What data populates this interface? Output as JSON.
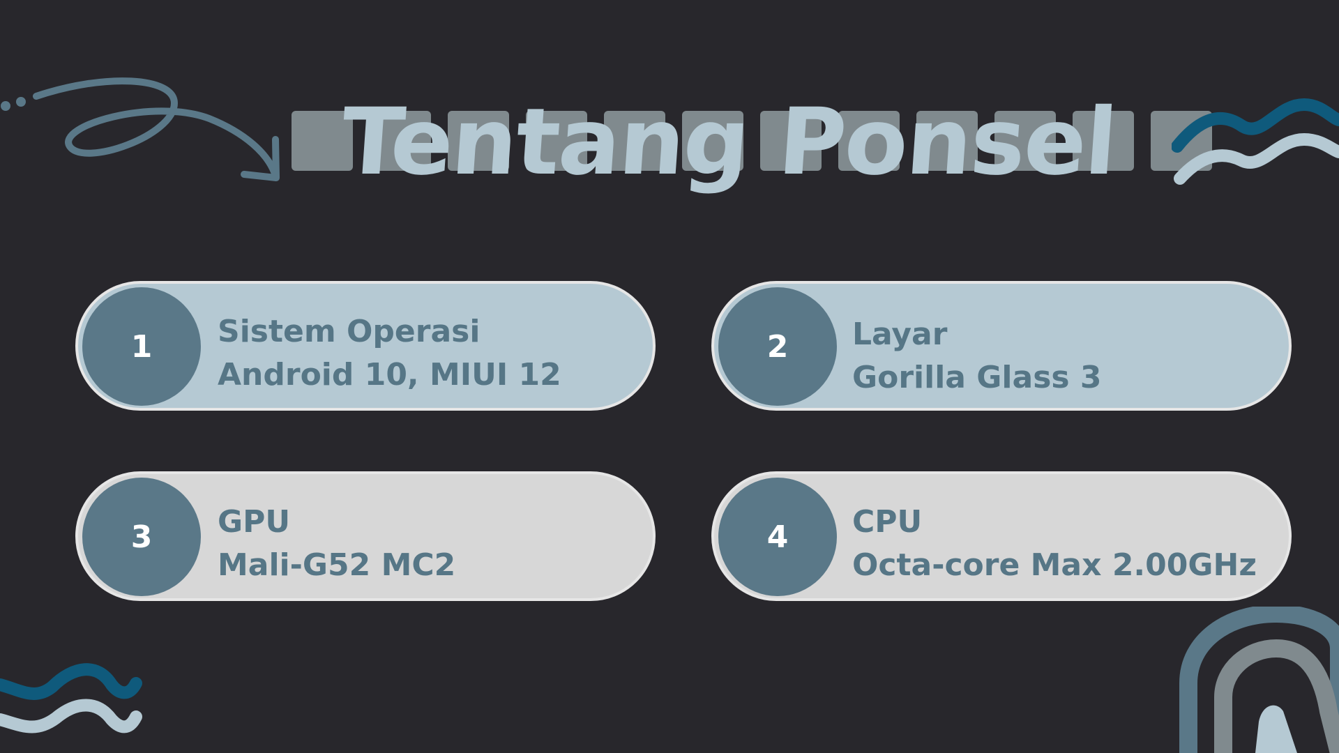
{
  "title": "Tentang Ponsel",
  "colors": {
    "background": "#28272c",
    "accent_light": "#b5c9d3",
    "accent_dark": "#5a7888",
    "card_gray": "#d7d7d7",
    "square": "#808a8e",
    "wave_dark": "#0f5a7c"
  },
  "items": [
    {
      "number": "1",
      "heading": "Sistem Operasi",
      "value": "Android 10, MIUI 12"
    },
    {
      "number": "2",
      "heading": "Layar",
      "value": "Gorilla Glass 3"
    },
    {
      "number": "3",
      "heading": "GPU",
      "value": "Mali-G52 MC2"
    },
    {
      "number": "4",
      "heading": "CPU",
      "value": "Octa-core Max 2.00GHz"
    }
  ],
  "decorations": [
    "curly-arrow-icon",
    "wave-icon",
    "arch-icon"
  ]
}
